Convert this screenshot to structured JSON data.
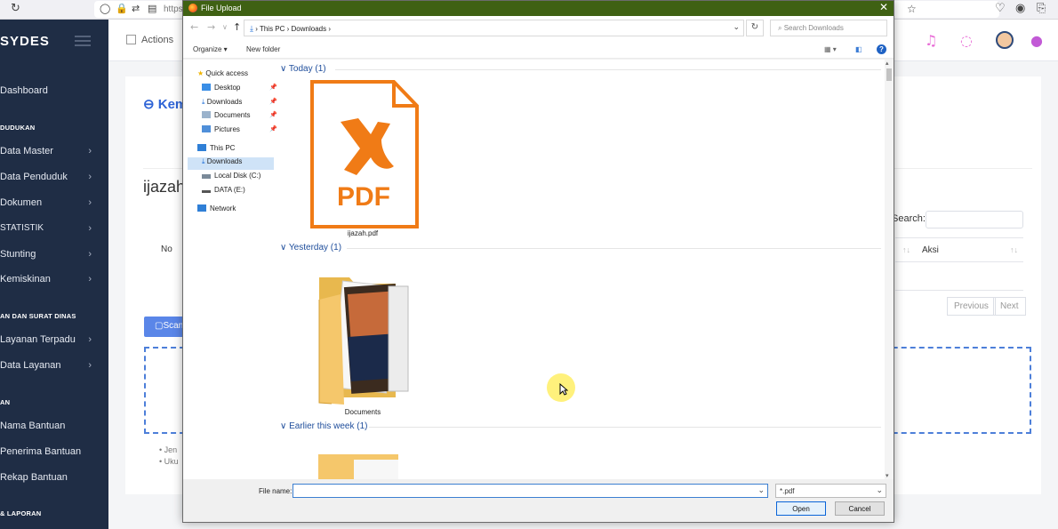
{
  "browser": {
    "url_fragment": "https"
  },
  "sidebar": {
    "brand": "SYDES",
    "items": [
      {
        "label": "Dashboard",
        "chevron": false
      },
      {
        "label": "Data Master",
        "chevron": true
      },
      {
        "label": "Data Penduduk",
        "chevron": true
      },
      {
        "label": "Dokumen",
        "chevron": true
      },
      {
        "label": "STATISTIK",
        "chevron": true
      },
      {
        "label": "Stunting",
        "chevron": true
      },
      {
        "label": "Kemiskinan",
        "chevron": true
      },
      {
        "label": "Layanan Terpadu",
        "chevron": true
      },
      {
        "label": "Data Layanan",
        "chevron": true
      },
      {
        "label": "Nama Bantuan",
        "chevron": false
      },
      {
        "label": "Penerima Bantuan",
        "chevron": false
      },
      {
        "label": "Rekap Bantuan",
        "chevron": false
      }
    ],
    "sections": [
      "DUDUKAN",
      "AN DAN SURAT DINAS",
      "AN",
      "& LAPORAN"
    ]
  },
  "topbar": {
    "actions_label": "Actions"
  },
  "page": {
    "back_label": "Kem",
    "doc_title": "ijazah",
    "col_no": "No",
    "col_aksi": "Aksi",
    "search_label": "Search:",
    "prev_label": "Previous",
    "next_label": "Next",
    "scan_label": "Scan",
    "bullets": [
      "Jen",
      "Uku"
    ]
  },
  "dialog": {
    "title": "File Upload",
    "breadcrumb": "This PC  ›  Downloads  ›",
    "search_placeholder": "Search Downloads",
    "organize_label": "Organize ▾",
    "new_folder_label": "New folder",
    "nav": {
      "quick_access": "Quick access",
      "desktop": "Desktop",
      "downloads_qa": "Downloads",
      "documents": "Documents",
      "pictures": "Pictures",
      "this_pc": "This PC",
      "downloads_pc": "Downloads",
      "local_disk": "Local Disk (C:)",
      "data_e": "DATA (E:)",
      "network": "Network"
    },
    "groups": [
      "Today (1)",
      "Yesterday (1)",
      "Earlier this week (1)"
    ],
    "files": {
      "pdf_name": "ijazah.pdf",
      "pdf_badge": "PDF",
      "folder_name": "Documents"
    },
    "file_name_label": "File name:",
    "file_name_value": "",
    "filter_value": "*.pdf",
    "open_label": "Open",
    "cancel_label": "Cancel"
  },
  "colors": {
    "sidebar_bg": "#1f2d45",
    "dialog_title_bg": "#3f6113",
    "accent_blue": "#2d63d6",
    "pdf_orange": "#f07b16"
  }
}
